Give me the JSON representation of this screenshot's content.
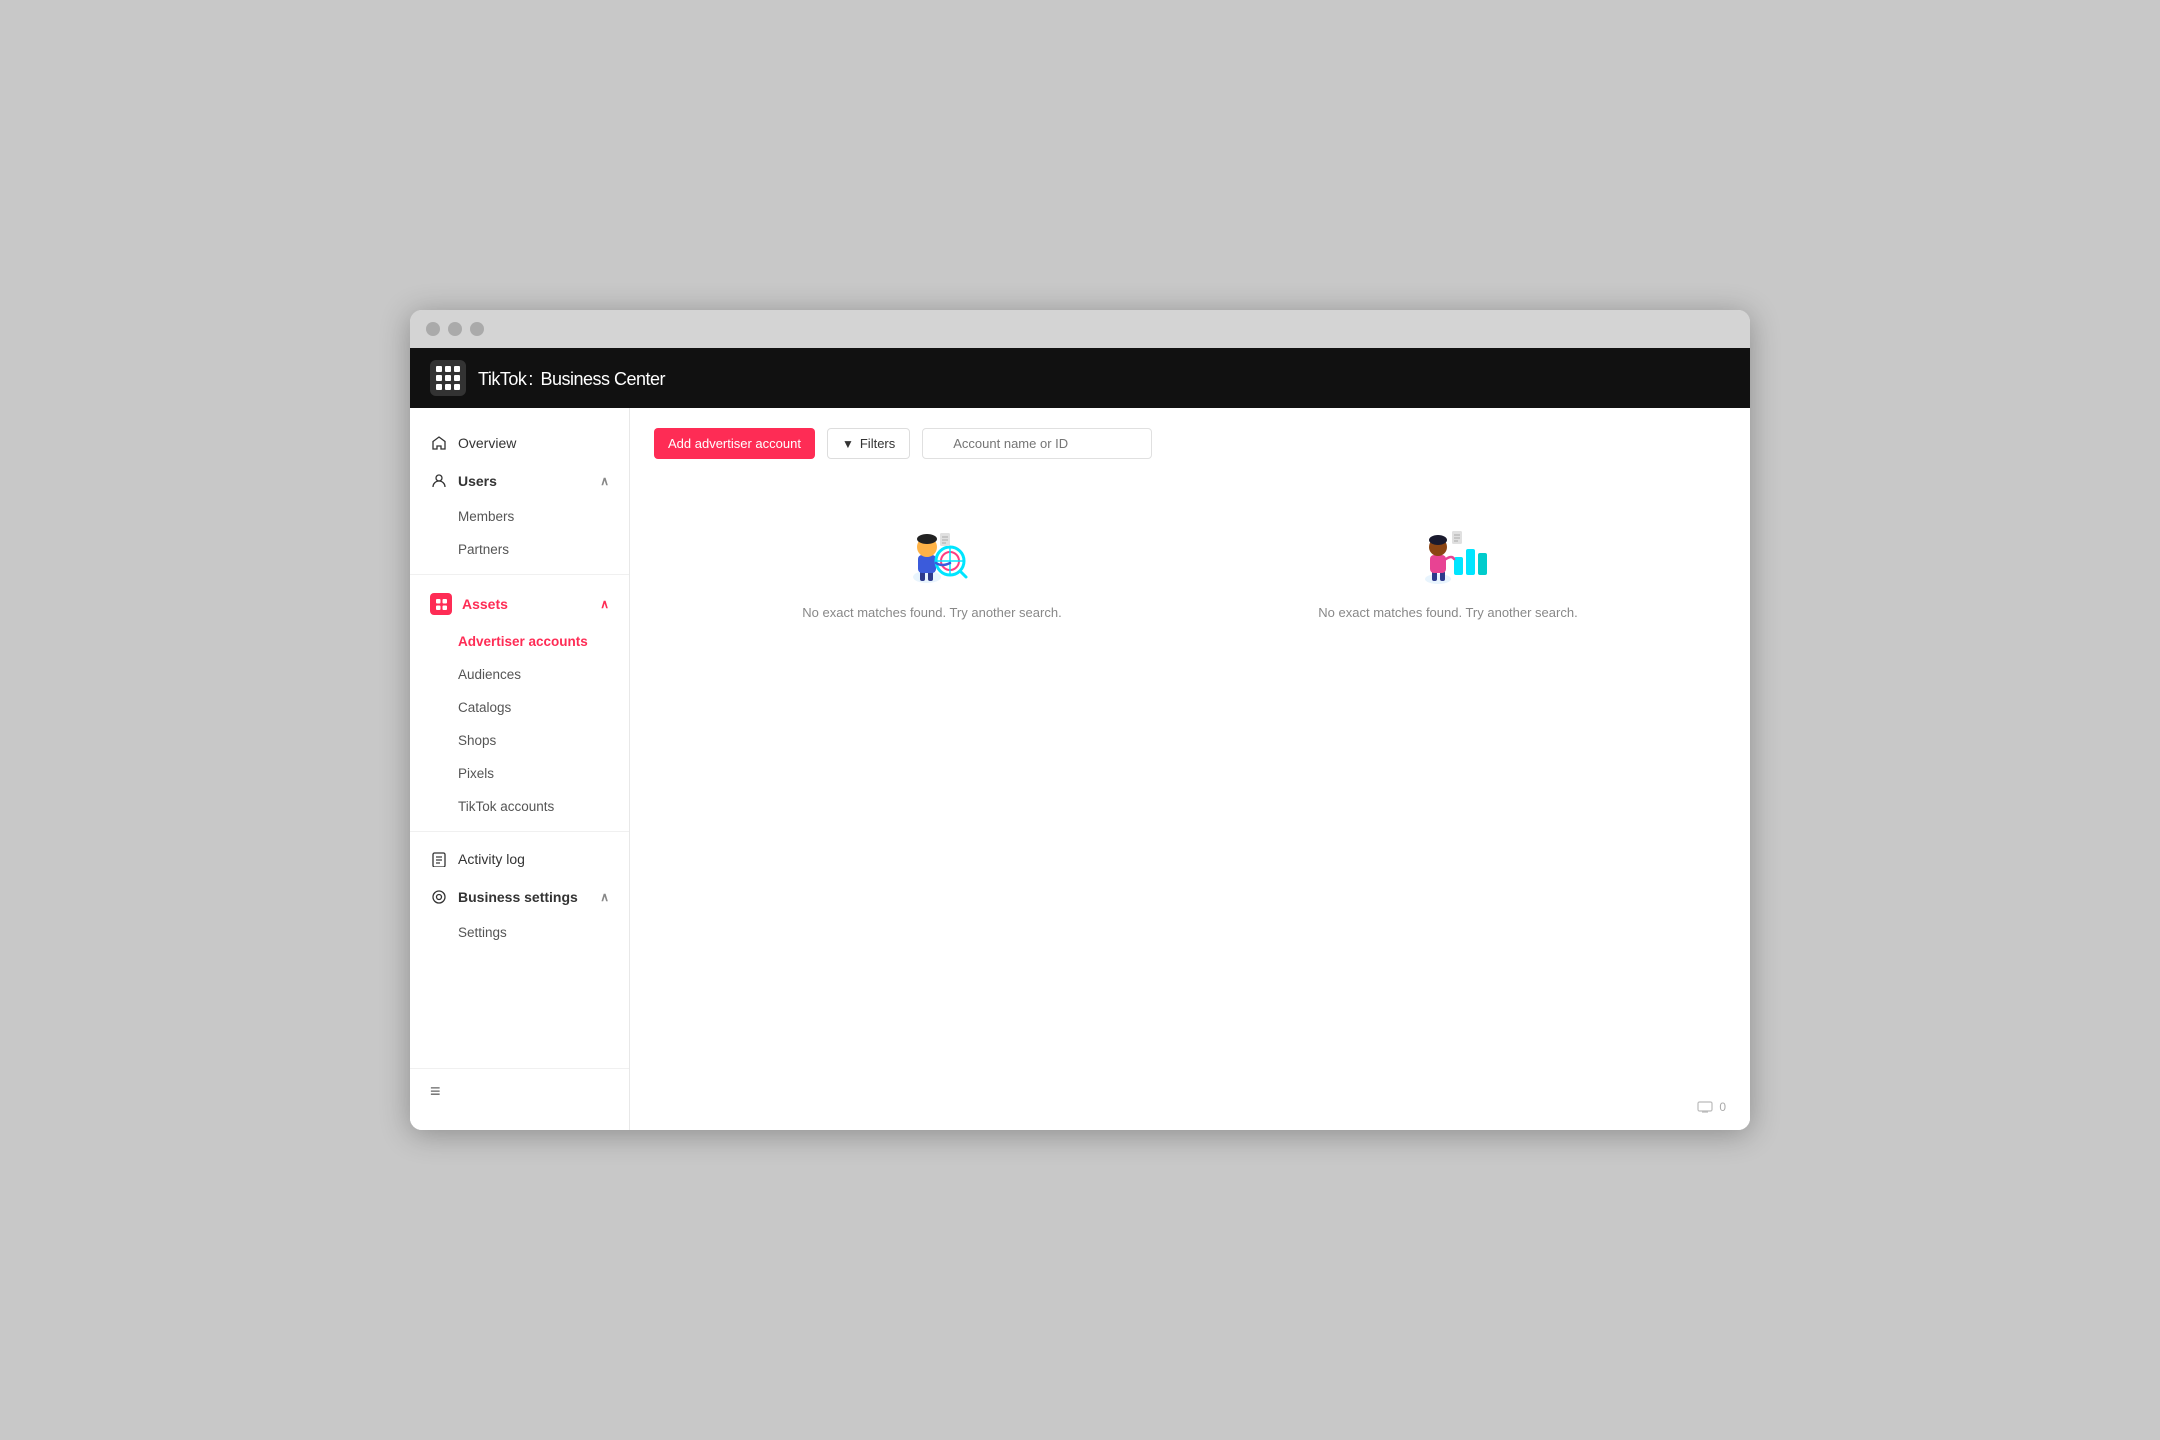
{
  "browser": {
    "dots": [
      "dot1",
      "dot2",
      "dot3"
    ]
  },
  "topnav": {
    "logo": "TikTok",
    "separator": ":",
    "subtitle": "Business Center",
    "grid_label": "apps-grid"
  },
  "sidebar": {
    "overview_label": "Overview",
    "users_label": "Users",
    "users_chevron": "∧",
    "members_label": "Members",
    "partners_label": "Partners",
    "assets_label": "Assets",
    "assets_chevron": "∧",
    "advertiser_accounts_label": "Advertiser accounts",
    "audiences_label": "Audiences",
    "catalogs_label": "Catalogs",
    "shops_label": "Shops",
    "pixels_label": "Pixels",
    "tiktok_accounts_label": "TikTok accounts",
    "activity_log_label": "Activity log",
    "business_settings_label": "Business settings",
    "business_settings_chevron": "∧",
    "settings_label": "Settings",
    "collapse_icon": "≡"
  },
  "content": {
    "add_button_label": "Add advertiser account",
    "filters_button_label": "Filters",
    "search_placeholder": "Account name or ID",
    "empty_state_text": "No exact matches found. Try another search.",
    "empty_state_text2": "No exact matches found. Try another search.",
    "footer_count": "0"
  }
}
